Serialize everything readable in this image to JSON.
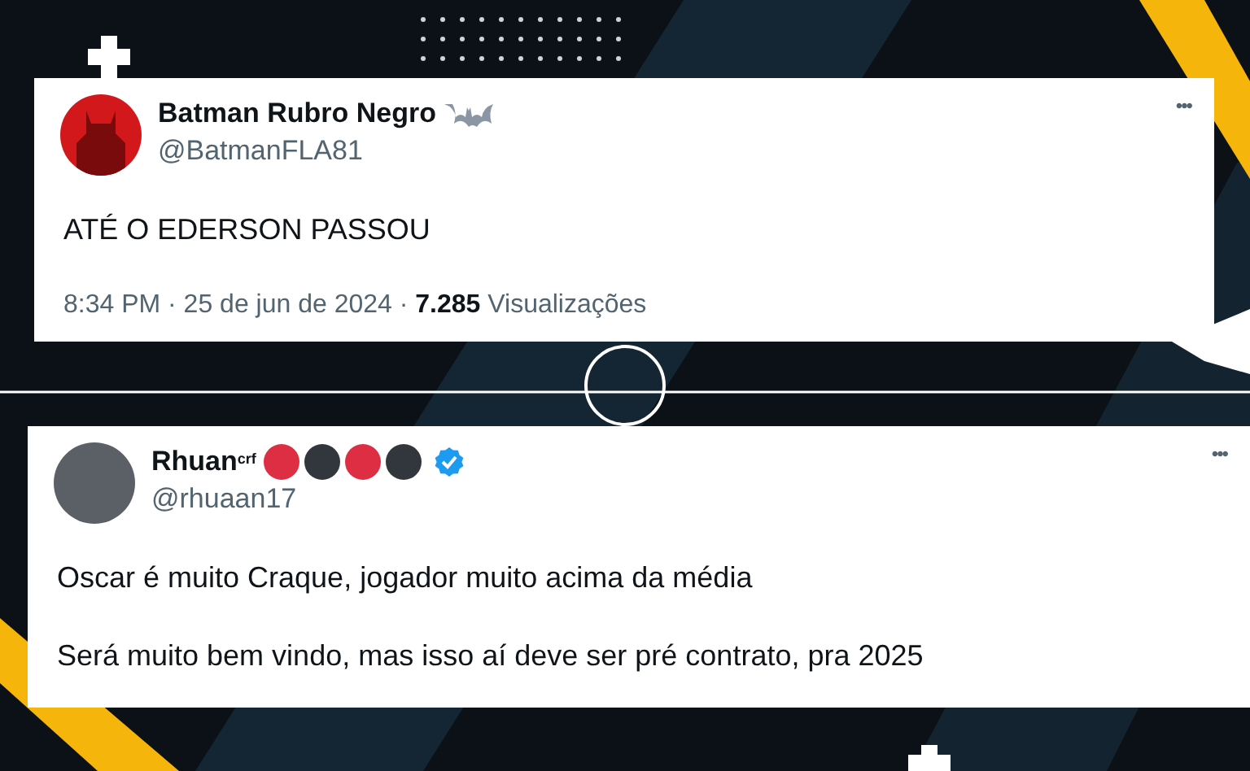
{
  "tweets": [
    {
      "name": "Batman Rubro Negro",
      "badges": [
        {
          "kind": "bat"
        }
      ],
      "handle": "@BatmanFLA81",
      "avatar": {
        "kind": "logo"
      },
      "more": "•••",
      "paragraphs": [
        "ATÉ O EDERSON PASSOU"
      ],
      "meta": "8:34 PM · 25 de jun de 2024 · **7.285** Visualizações"
    },
    {
      "name": "Rhuan$^{crf}$",
      "badges": [
        {
          "kind": "dot",
          "color": "#dd2e44"
        },
        {
          "kind": "dot",
          "color": "#31373d"
        },
        {
          "kind": "dot",
          "color": "#dd2e44"
        },
        {
          "kind": "dot",
          "color": "#31373d"
        },
        {
          "kind": "verified"
        }
      ],
      "handle": "@rhuaan17",
      "avatar": {
        "kind": "photo"
      },
      "more": "•••",
      "paragraphs": [
        "Oscar é muito Craque, jogador muito acima da média",
        "Será muito bem vindo, mas isso aí deve ser pré contrato, pra 2025"
      ]
    }
  ]
}
